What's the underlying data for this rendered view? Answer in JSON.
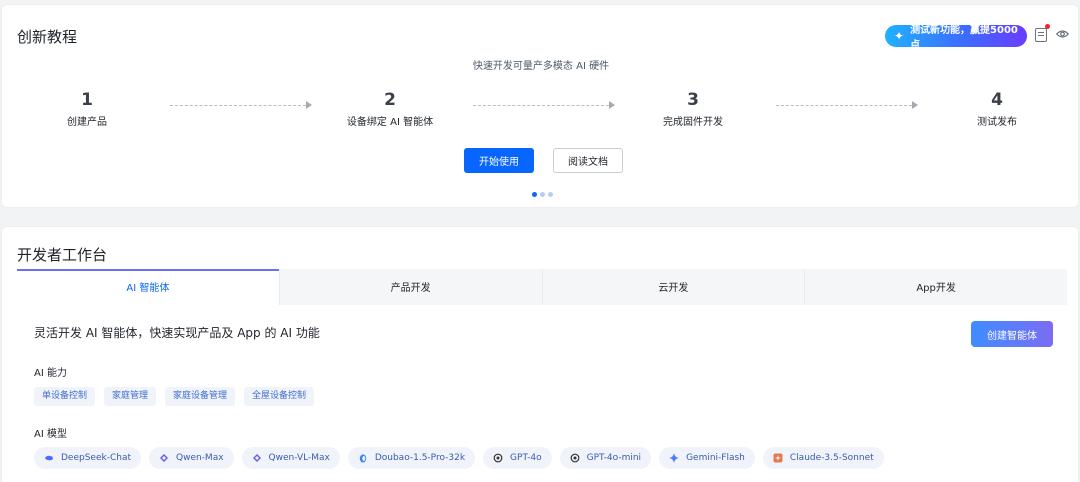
{
  "tutorial": {
    "title": "创新教程",
    "promo_label": "测试新功能，赢提5000点",
    "subtitle": "快速开发可量产多模态 AI 硬件",
    "steps": [
      {
        "num": "1",
        "label": "创建产品"
      },
      {
        "num": "2",
        "label": "设备绑定 AI 智能体"
      },
      {
        "num": "3",
        "label": "完成固件开发"
      },
      {
        "num": "4",
        "label": "测试发布"
      }
    ],
    "start_button": "开始使用",
    "docs_button": "阅读文档",
    "carousel_active_index": 0
  },
  "workbench": {
    "title": "开发者工作台",
    "tabs": [
      {
        "label": "AI 智能体",
        "active": true
      },
      {
        "label": "产品开发",
        "active": false
      },
      {
        "label": "云开发",
        "active": false
      },
      {
        "label": "App开发",
        "active": false
      }
    ],
    "description": "灵活开发 AI 智能体，快速实现产品及 App 的 AI 功能",
    "create_button": "创建智能体",
    "capability_label": "AI 能力",
    "capabilities": [
      "单设备控制",
      "家庭管理",
      "家庭设备管理",
      "全屋设备控制"
    ],
    "model_label": "AI 模型",
    "models": [
      {
        "name": "DeepSeek-Chat",
        "icon": "deepseek-whale-icon",
        "color": "#4d6bfe"
      },
      {
        "name": "Qwen-Max",
        "icon": "qwen-icon",
        "color": "#6c5ce7"
      },
      {
        "name": "Qwen-VL-Max",
        "icon": "qwen-icon",
        "color": "#6c5ce7"
      },
      {
        "name": "Doubao-1.5-Pro-32k",
        "icon": "doubao-icon",
        "color": "#3b82f6"
      },
      {
        "name": "GPT-4o",
        "icon": "openai-icon",
        "color": "#333333"
      },
      {
        "name": "GPT-4o-mini",
        "icon": "openai-icon",
        "color": "#333333"
      },
      {
        "name": "Gemini-Flash",
        "icon": "gemini-spark-icon",
        "color": "#4a7cf7"
      },
      {
        "name": "Claude-3.5-Sonnet",
        "icon": "claude-icon",
        "color": "#e07a4f"
      }
    ]
  },
  "colors": {
    "primary": "#0866ff",
    "tag_bg": "#f0f3fa"
  }
}
